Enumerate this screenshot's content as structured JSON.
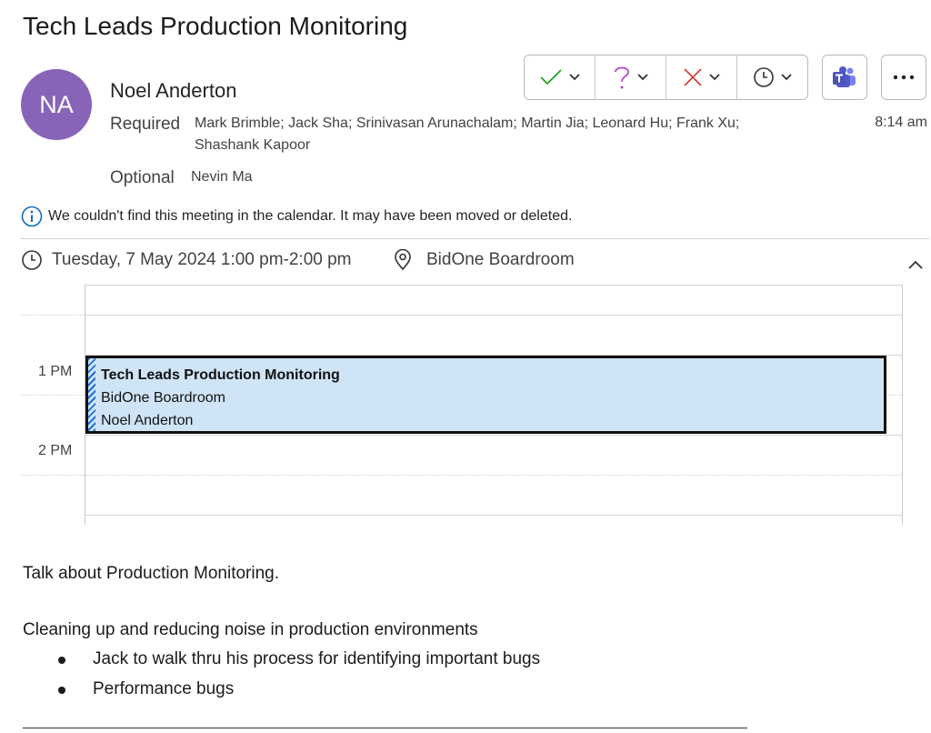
{
  "message": {
    "subject": "Tech Leads Production Monitoring",
    "sender": {
      "initials": "NA",
      "name": "Noel Anderton",
      "avatar_color": "#8764b8"
    },
    "required_label": "Required",
    "required_line1": "Mark Brimble; Jack Sha; Srinivasan Arunachalam; Martin Jia; Leonard Hu; Frank Xu;",
    "required_line2": "Shashank Kapoor",
    "optional_label": "Optional",
    "optional_names": "Nevin Ma",
    "time": "8:14 am"
  },
  "toolbar": {
    "accept_color": "#13a10e",
    "tentative_color": "#b146c2",
    "decline_color": "#d13438"
  },
  "notice": "We couldn't find this meeting in the calendar. It may have been moved or deleted.",
  "meeting": {
    "datetime": "Tuesday, 7 May 2024 1:00 pm-2:00 pm",
    "location": "BidOne Boardroom"
  },
  "calendar": {
    "hours": [
      "1 PM",
      "2 PM"
    ],
    "event": {
      "title": "Tech Leads Production Monitoring",
      "location": "BidOne Boardroom",
      "organizer": "Noel Anderton",
      "background": "#cfe4f6"
    }
  },
  "body": {
    "intro": "Talk about Production Monitoring.",
    "section": "Cleaning up and reducing noise in production environments",
    "bullets": [
      "Jack to walk thru his process for identifying important bugs",
      "Performance bugs"
    ]
  }
}
